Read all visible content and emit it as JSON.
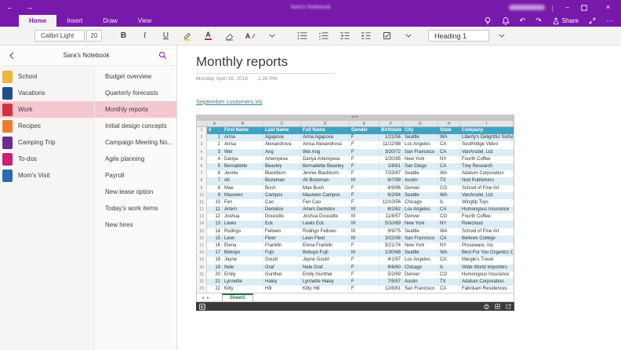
{
  "colors": {
    "accent_purple": "#7719aa",
    "selection_pink": "#f5c8d0",
    "table_header_teal": "#41a3c2",
    "table_alt_row": "#dcedf6",
    "link_teal": "#3c7b82"
  },
  "titlebar": {
    "window_title": "Sara's Notebook"
  },
  "ribbon": {
    "tabs": [
      {
        "label": "Home",
        "active": true
      },
      {
        "label": "Insert",
        "active": false
      },
      {
        "label": "Draw",
        "active": false
      },
      {
        "label": "View",
        "active": false
      }
    ],
    "share_label": "Share"
  },
  "toolbar": {
    "font_name": "Calibri Light",
    "font_size": "20",
    "style_selector": "Heading 1"
  },
  "sidebar": {
    "notebook_title": "Sara's Notebook",
    "sections": [
      {
        "label": "School",
        "color": "#edb63e",
        "selected": false
      },
      {
        "label": "Vacations",
        "color": "#1d4e89",
        "selected": false
      },
      {
        "label": "Work",
        "color": "#d03341",
        "selected": true
      },
      {
        "label": "Recipes",
        "color": "#ee7b2d",
        "selected": false
      },
      {
        "label": "Camping Trip",
        "color": "#6b2d90",
        "selected": false
      },
      {
        "label": "To-dos",
        "color": "#cc2179",
        "selected": false
      },
      {
        "label": "Mom's Visit",
        "color": "#2a6bad",
        "selected": false
      }
    ],
    "pages": [
      {
        "label": "Budget overview",
        "selected": false
      },
      {
        "label": "Quarterly forecasts",
        "selected": false
      },
      {
        "label": "Monthly reports",
        "selected": true
      },
      {
        "label": "Initial design concepts",
        "selected": false
      },
      {
        "label": "Campaign Meeting No...",
        "selected": false
      },
      {
        "label": "Agile planning",
        "selected": false
      },
      {
        "label": "Payroll",
        "selected": false
      },
      {
        "label": "New lease option",
        "selected": false
      },
      {
        "label": "Today's work items",
        "selected": false
      },
      {
        "label": "New hires",
        "selected": false
      }
    ]
  },
  "page": {
    "title": "Monthly reports",
    "date": "Monday, April 16, 2018",
    "time": "1:26 PM",
    "attachment_link": "September customers.xls"
  },
  "embed": {
    "drag_handle_dots": "•••"
  },
  "spreadsheet": {
    "sheet_tab": "Sheet1",
    "column_letters": [
      "A",
      "B",
      "C",
      "D",
      "E",
      "F",
      "G",
      "H",
      "I"
    ],
    "headers": [
      "#",
      "First Name",
      "Last Name",
      "Full Name",
      "Gender",
      "Birthdate",
      "City",
      "State",
      "Company"
    ],
    "rows": [
      [
        "1",
        "Arina",
        "Agapova",
        "Arina Agapova",
        "F",
        "1/21/56",
        "Seattle",
        "WA",
        "Liberty's Delightful Sinful Bakery"
      ],
      [
        "2",
        "Anisa",
        "Alexandrova",
        "Anisa Alexandrova",
        "F",
        "11/22/88",
        "Los Angeles",
        "CA",
        "Southridge Video"
      ],
      [
        "3",
        "Wei",
        "Ang",
        "Wei Ang",
        "F",
        "3/20/72",
        "San Francisco",
        "CA",
        "VanArsdel, Ltd."
      ],
      [
        "4",
        "Dariya",
        "Artemyeva",
        "Dariya Artemyeva",
        "F",
        "1/20/85",
        "New York",
        "NY",
        "Fourth Coffee"
      ],
      [
        "5",
        "Bernadette",
        "Beasley",
        "Bernadette Beasley",
        "F",
        "1/8/61",
        "San Diego",
        "CA",
        "Trey Research"
      ],
      [
        "6",
        "Jennie",
        "Blackburn",
        "Jennie Blackburn",
        "F",
        "7/23/87",
        "Seattle",
        "WA",
        "Adatum Corporation"
      ],
      [
        "7",
        "Ali",
        "Bozeman",
        "Ali Bozeman",
        "M",
        "6/7/99",
        "Austin",
        "TX",
        "Nod Publishers"
      ],
      [
        "8",
        "Mae",
        "Bush",
        "Mae Bush",
        "F",
        "4/9/96",
        "Denver",
        "CO",
        "School of Fine Art"
      ],
      [
        "9",
        "Maureen",
        "Campos",
        "Maureen Campos",
        "F",
        "6/2/94",
        "Seattle",
        "WA",
        "VanArsdel, Ltd."
      ],
      [
        "10",
        "Fen",
        "Cao",
        "Fen Cao",
        "F",
        "12/10/56",
        "Chicago",
        "IL",
        "Wingtip Toys"
      ],
      [
        "11",
        "Artem",
        "Demidov",
        "Artem Demidov",
        "M",
        "6/2/62",
        "Los Angeles",
        "CA",
        "Humongous Insurance"
      ],
      [
        "12",
        "Joshua",
        "Doucette",
        "Joshua Doucette",
        "M",
        "11/8/57",
        "Denver",
        "CO",
        "Fourth Coffee"
      ],
      [
        "13",
        "Lewis",
        "Eck",
        "Lewis Eck",
        "M",
        "5/10/69",
        "New York",
        "NY",
        "Relecloud"
      ],
      [
        "14",
        "Rodrigo",
        "Fellows",
        "Rodrigo Fellows",
        "M",
        "9/9/75",
        "Seattle",
        "WA",
        "School of Fine Art"
      ],
      [
        "15",
        "Leon",
        "Fleer",
        "Leon Fleer",
        "M",
        "3/22/56",
        "San Francisco",
        "CA",
        "Bellows College"
      ],
      [
        "16",
        "Elena",
        "Franklin",
        "Elena Franklin",
        "F",
        "5/21/74",
        "New York",
        "NY",
        "Proseware, Inc."
      ],
      [
        "17",
        "Bokuyo",
        "Fujii",
        "Bokuyo Fujii",
        "M",
        "1/30/68",
        "Seattle",
        "WA",
        "Best For You Organics Company"
      ],
      [
        "18",
        "Jayne",
        "Gould",
        "Jayne Gould",
        "F",
        "4/1/97",
        "Los Angeles",
        "CA",
        "Margie's Travel"
      ],
      [
        "19",
        "Nele",
        "Graf",
        "Nele Graf",
        "F",
        "8/6/60",
        "Chicago",
        "IL",
        "Wide World Importers"
      ],
      [
        "20",
        "Emily",
        "Gunther",
        "Emily Gunther",
        "F",
        "5/2/69",
        "Denver",
        "CO",
        "Humongous Insurance"
      ],
      [
        "21",
        "Lynnette",
        "Haley",
        "Lynnette Haley",
        "F",
        "7/5/57",
        "Austin",
        "TX",
        "Adatum Corporation"
      ],
      [
        "22",
        "Kitty",
        "Hill",
        "Kitty Hill",
        "F",
        "12/8/81",
        "San Francisco",
        "CA",
        "Fabrikam Residences"
      ]
    ]
  }
}
